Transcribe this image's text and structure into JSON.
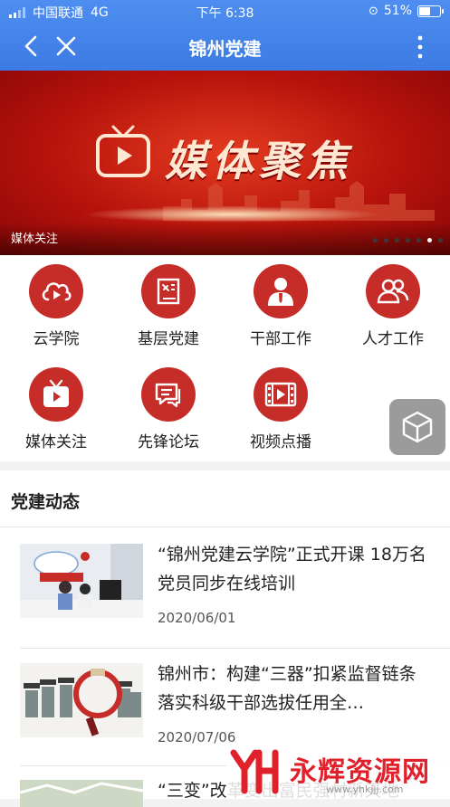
{
  "status": {
    "carrier": "中国联通",
    "network": "4G",
    "time": "下午 6:38",
    "battery": "51%"
  },
  "nav": {
    "title": "锦州党建"
  },
  "banner": {
    "headline": "媒体聚焦",
    "caption": "媒体关注",
    "dots": 7,
    "active_dot": 5
  },
  "grid": {
    "items": [
      {
        "label": "云学院",
        "icon": "cloud-play-icon"
      },
      {
        "label": "基层党建",
        "icon": "party-book-icon"
      },
      {
        "label": "干部工作",
        "icon": "cadre-person-icon"
      },
      {
        "label": "人才工作",
        "icon": "people-group-icon"
      },
      {
        "label": "媒体关注",
        "icon": "tv-icon"
      },
      {
        "label": "先锋论坛",
        "icon": "forum-chat-icon"
      },
      {
        "label": "视频点播",
        "icon": "film-icon"
      }
    ]
  },
  "news": {
    "heading": "党建动态",
    "items": [
      {
        "title": "“锦州党建云学院”正式开课 18万名党员同步在线培训",
        "date": "2020/06/01"
      },
      {
        "title": "锦州市：构建“三器”扣紧监督链条 落实科级干部选拔任用全…",
        "date": "2020/07/06"
      },
      {
        "title": "“三变”改革变出富民强村新天地",
        "date": ""
      }
    ]
  },
  "watermark": {
    "text": "永辉资源网",
    "url": "www.yhkjjj.com"
  }
}
